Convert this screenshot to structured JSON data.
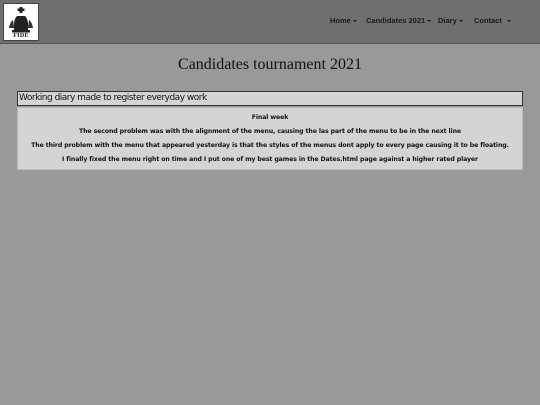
{
  "nav": {
    "logo_text": "FIDE",
    "items": [
      {
        "label": "Home"
      },
      {
        "label": "Candidates 2021"
      },
      {
        "label": "Diary"
      },
      {
        "label": "Contact"
      }
    ]
  },
  "page": {
    "title": "Candidates tournament 2021",
    "subtitle": "Working diary made to register everyday work",
    "lines": [
      "Final week",
      "The second problem was with the alignment of the menu, causing the las part of the menu to be in the next line",
      "The third problem with the menu that appeared yesterday is that the styles of the menus dont apply to every page causing it to be floating.",
      "I finally fixed the menu right on time and I put one of my best games in the Dates.html page against a higher rated player"
    ]
  }
}
